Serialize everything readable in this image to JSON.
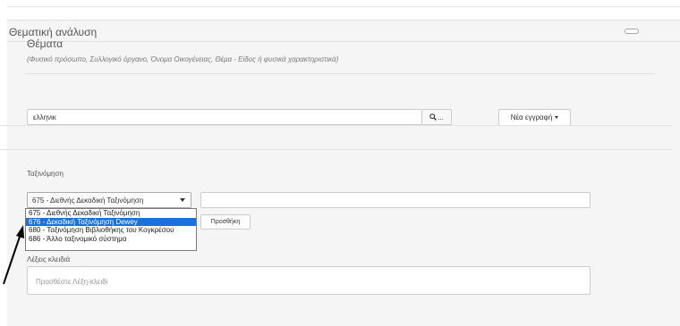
{
  "panel": {
    "title": "Θεματική ανάλυση"
  },
  "subjects": {
    "title": "Θέματα",
    "hint": "(Φυσικό πρόσωπο, Συλλογικό όργανο, Όνομα Οικογένειας, Θέμα - Είδος ή φυσικά χαρακτηριστικά)",
    "search_value": "ελληνικ",
    "search_button_label": "...",
    "new_record_label": "Νέα εγγραφή"
  },
  "classification": {
    "label": "Ταξινόμηση",
    "selected": "675 - Διεθνής Δεκαδική Ταξινόμηση",
    "options": [
      "675 - Διεθνής Δεκαδική Ταξινόμηση",
      "676 - Δεκαδική Ταξινόμηση Dewey",
      "680 - Ταξινόμηση Βιβλιοθήκης του Κογκρέσου",
      "686 - Άλλο ταξινομικό σύστημα"
    ],
    "highlighted_index": 1,
    "add_button_label": "Προσθήκη"
  },
  "keywords": {
    "label": "Λέξεις κλειδιά",
    "placeholder": "Προσθέστε Λέξη-κλειδί"
  },
  "colors": {
    "highlight": "#1e6fd9",
    "panel_bg": "#f5f5f5"
  },
  "icons": {
    "search": "search-icon",
    "caret": "caret-down-icon",
    "annotation": "annotation-arrow-icon"
  }
}
